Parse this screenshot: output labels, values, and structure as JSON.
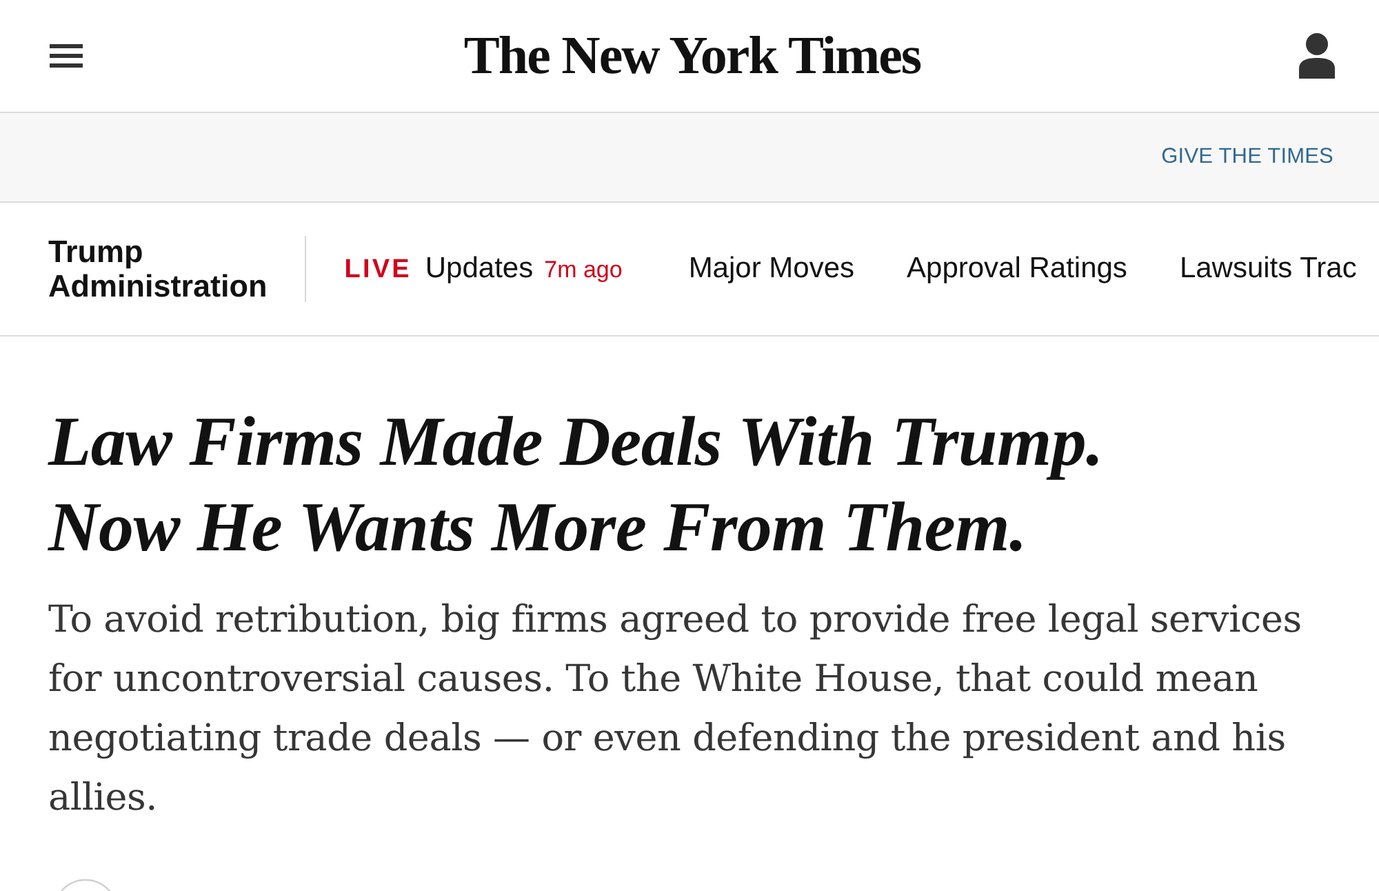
{
  "header": {
    "masthead": "The New York Times"
  },
  "promo_bar": {
    "link": "GIVE THE TIMES"
  },
  "section_nav": {
    "section": "Trump Administration",
    "items": [
      {
        "kind": "live",
        "badge": "LIVE",
        "label": "Updates",
        "time": "7m ago"
      },
      {
        "kind": "link",
        "label": "Major Moves"
      },
      {
        "kind": "link",
        "label": "Approval Ratings"
      },
      {
        "kind": "link",
        "label": "Lawsuits Trac"
      }
    ]
  },
  "article": {
    "headline": "Law Firms Made Deals With Trump. Now He Wants More From Them.",
    "summary": "To avoid retribution, big firms agreed to provide free legal services for uncontroversial causes. To the White House, that could mean negotiating trade deals — or even defending the president and his allies."
  }
}
